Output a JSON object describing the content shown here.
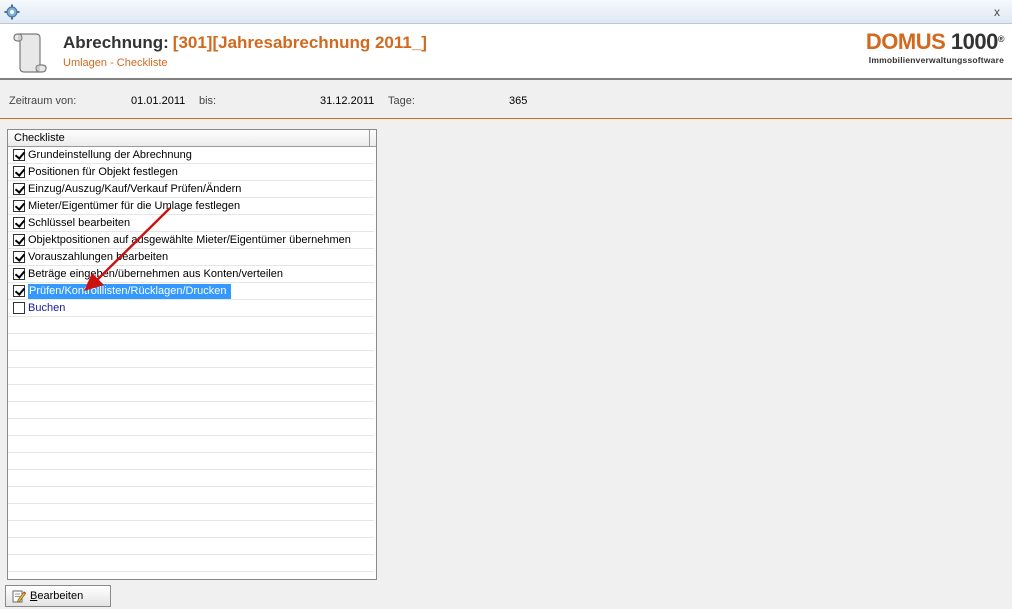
{
  "titlebar": {
    "close_label": "x"
  },
  "header": {
    "title": "Abrechnung:",
    "title_accent": "[301][Jahresabrechnung 2011_]",
    "subtitle": "Umlagen - Checkliste"
  },
  "logo": {
    "brand": "DOMUS",
    "number": "1000",
    "reg": "®",
    "tagline": "Immobilienverwaltungssoftware"
  },
  "period": {
    "from_label": "Zeitraum von:",
    "from_value": "01.01.2011",
    "to_label": "bis:",
    "to_value": "31.12.2011",
    "days_label": "Tage:",
    "days_value": "365"
  },
  "checklist": {
    "header": "Checkliste",
    "items": [
      {
        "label": "Grundeinstellung der Abrechnung",
        "checked": true
      },
      {
        "label": "Positionen für Objekt festlegen",
        "checked": true
      },
      {
        "label": "Einzug/Auszug/Kauf/Verkauf Prüfen/Ändern",
        "checked": true
      },
      {
        "label": "Mieter/Eigentümer für die Umlage festlegen",
        "checked": true
      },
      {
        "label": "Schlüssel bearbeiten",
        "checked": true
      },
      {
        "label": "Objektpositionen auf ausgewählte Mieter/Eigentümer übernehmen",
        "checked": true
      },
      {
        "label": "Vorauszahlungen bearbeiten",
        "checked": true
      },
      {
        "label": "Beträge eingeben/übernehmen aus Konten/verteilen",
        "checked": true
      },
      {
        "label": "Prüfen/Kontrolllisten/Rücklagen/Drucken",
        "checked": true,
        "selected": true
      },
      {
        "label": "Buchen",
        "checked": false
      }
    ]
  },
  "footer": {
    "edit_button_label_first": "B",
    "edit_button_label_rest": "earbeiten"
  },
  "colors": {
    "accent": "#d2691e",
    "selection": "#3399ff",
    "arrow": "#cc1111"
  }
}
